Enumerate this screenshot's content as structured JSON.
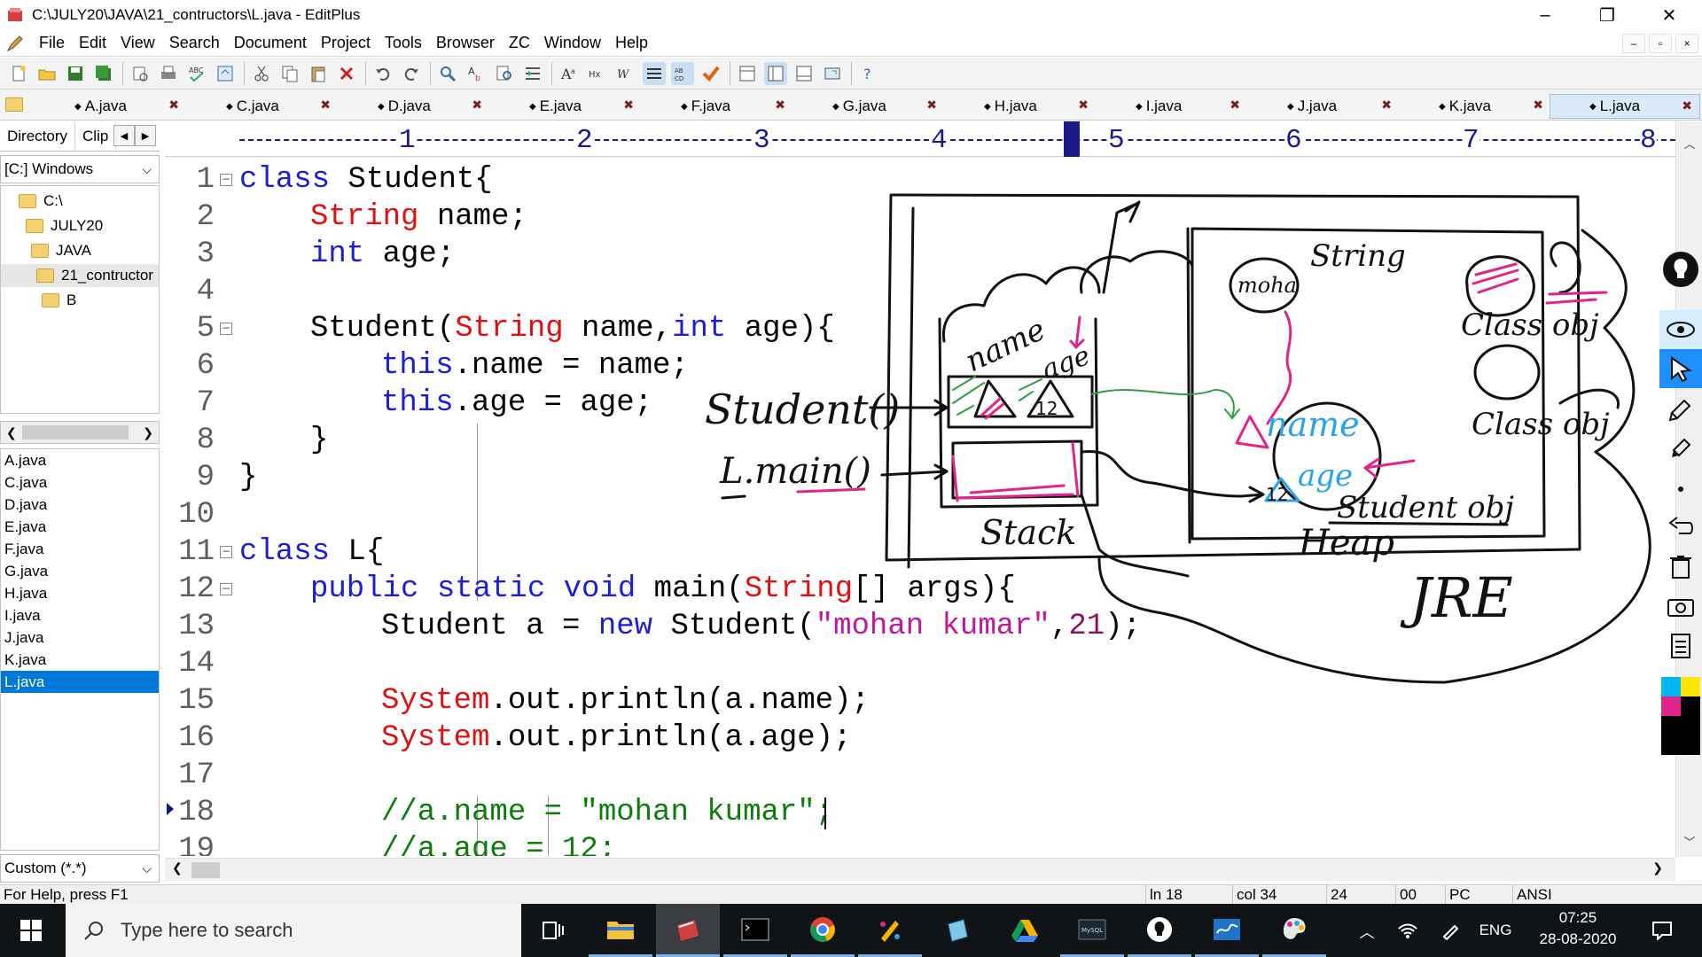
{
  "window": {
    "title": "C:\\JULY20\\JAVA\\21_contructors\\L.java - EditPlus",
    "minimize": "–",
    "maximize": "❐",
    "close": "✕"
  },
  "menu": [
    "File",
    "Edit",
    "View",
    "Search",
    "Document",
    "Project",
    "Tools",
    "Browser",
    "ZC",
    "Window",
    "Help"
  ],
  "mdi": {
    "minimize": "–",
    "restore": "▫",
    "close": "×"
  },
  "tabs": [
    "A.java",
    "C.java",
    "D.java",
    "E.java",
    "F.java",
    "G.java",
    "H.java",
    "I.java",
    "J.java",
    "K.java",
    "L.java"
  ],
  "active_tab": "L.java",
  "sidebar": {
    "tabs": [
      "Directory",
      "Clip"
    ],
    "drive": "[C:] Windows",
    "tree": [
      "C:\\",
      "JULY20",
      "JAVA",
      "21_contructor",
      "B"
    ],
    "files": [
      "A.java",
      "C.java",
      "D.java",
      "E.java",
      "F.java",
      "G.java",
      "H.java",
      "I.java",
      "J.java",
      "K.java",
      "L.java"
    ],
    "selected_file": "L.java",
    "filter": "Custom (*.*)"
  },
  "ruler": [
    "1",
    "2",
    "3",
    "4",
    "5",
    "6",
    "7",
    "8"
  ],
  "line_numbers": [
    "1",
    "2",
    "3",
    "4",
    "5",
    "6",
    "7",
    "8",
    "9",
    "10",
    "11",
    "12",
    "13",
    "14",
    "15",
    "16",
    "17",
    "18",
    "19"
  ],
  "code": {
    "l1_kw": "class",
    "l1_rest": " Student{",
    "l2_ty": "String",
    "l2_rest": " name;",
    "l3_kw": "int",
    "l3_rest": " age;",
    "l5_a": "Student(",
    "l5_ty": "String",
    "l5_b": " name,",
    "l5_kw": "int",
    "l5_c": " age){",
    "l6_kw": "this",
    "l6_rest": ".name = name;",
    "l7_kw": "this",
    "l7_rest": ".age = age;",
    "l8": "}",
    "l9": "}",
    "l11_kw": "class",
    "l11_rest": " L{",
    "l12_kw": "public static void",
    "l12_a": " main(",
    "l12_ty": "String",
    "l12_b": "[] args){",
    "l13_a": "Student a = ",
    "l13_kw": "new",
    "l13_b": " Student(",
    "l13_str": "\"mohan kumar\"",
    "l13_c": ",",
    "l13_num": "21",
    "l13_d": ");",
    "l15_ty": "System",
    "l15_rest": ".out.println(a.name);",
    "l16_ty": "System",
    "l16_rest": ".out.println(a.age);",
    "l18": "//a.name = \"mohan kumar\";",
    "l19": "//a.age = 12;"
  },
  "status": {
    "help": "For Help, press F1",
    "line": "ln 18",
    "col": "col 34",
    "c3": "24",
    "c4": "00",
    "c5": "PC",
    "c6": "ANSI"
  },
  "taskbar": {
    "search_placeholder": "Type here to search",
    "lang": "ENG",
    "time": "07:25",
    "date": "28-08-2020"
  },
  "icons": {
    "apps": [
      "task-view-icon",
      "file-explorer-icon",
      "editplus-icon",
      "terminal-icon",
      "chrome-icon",
      "paint-icon",
      "notepad-icon",
      "google-drive-icon",
      "mysql-icon",
      "lightbulb-icon",
      "whiteboard-icon",
      "paint3d-icon"
    ]
  },
  "colors": {
    "accent": "#0078d7",
    "keyword": "#1d1dd6",
    "type": "#e01010",
    "string": "#c0189a",
    "comment": "#0a7d0a"
  }
}
